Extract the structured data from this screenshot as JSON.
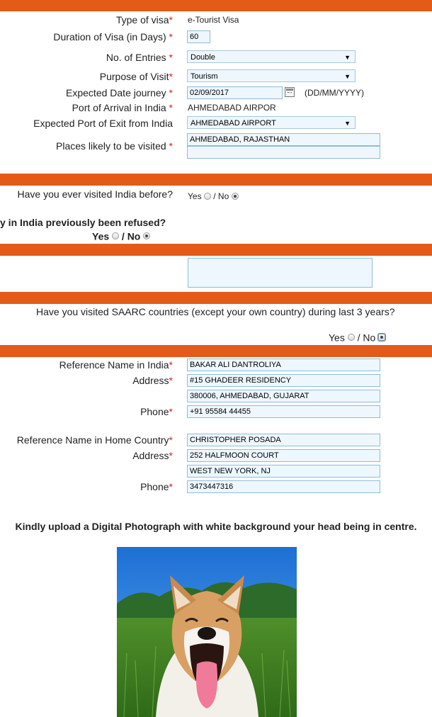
{
  "colors": {
    "accent_bar": "#e45b17",
    "required": "#d42020"
  },
  "visa": {
    "type_label": "Type of visa",
    "type_value": "e-Tourist Visa",
    "duration_label": "Duration of Visa (in Days)",
    "duration_value": "60",
    "entries_label": "No. of Entries",
    "entries_value": "Double",
    "purpose_label": "Purpose of Visit",
    "purpose_value": "Tourism",
    "date_label": "Expected Date journey",
    "date_value": "02/09/2017",
    "date_format": "(DD/MM/YYYY)",
    "arrival_label": "Port of Arrival in India",
    "arrival_value": "AHMEDABAD AIRPOR",
    "exit_label": "Expected Port of Exit from India",
    "exit_value": "AHMEDABAD AIRPORT",
    "places_label": "Places likely to be visited",
    "places_value_1": "AHMEDABAD, RAJASTHAN",
    "places_value_2": "",
    "required_mark": "*"
  },
  "previous": {
    "visited_question": "Have you ever visited India before?",
    "yes": "Yes",
    "no": "/ No",
    "refused_question": "y in India previously been refused?",
    "refused_yes": "Yes",
    "refused_no": "/ No",
    "visited_selection": "no",
    "refused_selection": "no"
  },
  "details_textarea": "",
  "saarc": {
    "question": "Have you visited SAARC countries (except your own country) during last 3 years?",
    "yes": "Yes",
    "no": "/ No",
    "selection": "no"
  },
  "reference_india": {
    "name_label": "Reference Name in India",
    "name_value": "BAKAR ALI DANTROLIYA",
    "address_label": "Address",
    "address_1": "#15 GHADEER RESIDENCY",
    "address_2": "380006, AHMEDABAD, GUJARAT",
    "phone_label": "Phone",
    "phone_value": "+91 95584 44455"
  },
  "reference_home": {
    "name_label": "Reference Name in Home Country",
    "name_value": "CHRISTOPHER POSADA",
    "address_label": "Address",
    "address_1": "252 HALFMOON COURT",
    "address_2": "WEST NEW YORK, NJ",
    "phone_label": "Phone",
    "phone_value": "3473447316"
  },
  "photo": {
    "instruction": "Kindly upload a Digital Photograph with white background your head being in centre."
  }
}
